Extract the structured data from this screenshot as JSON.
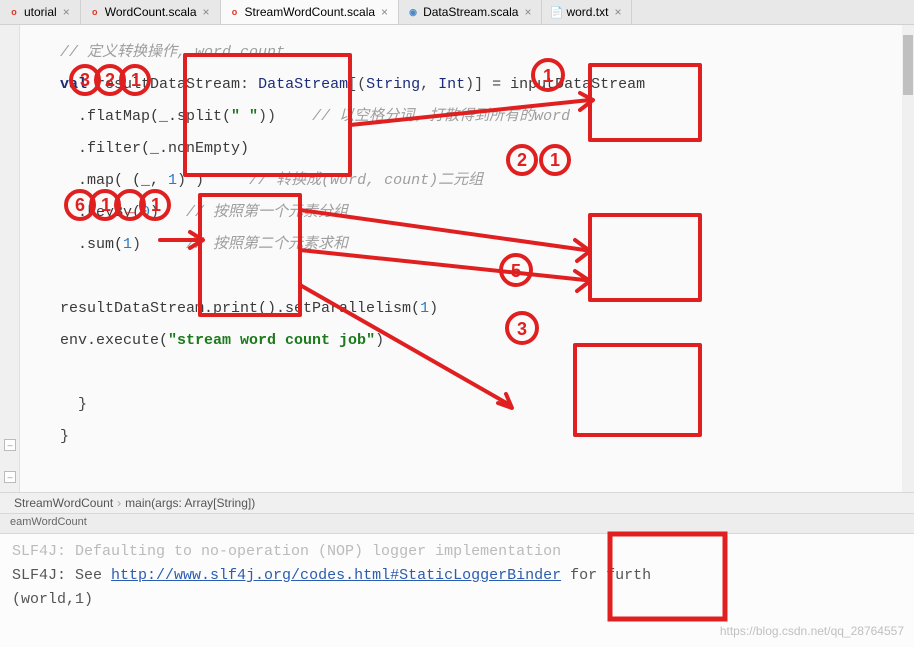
{
  "tabs": [
    {
      "name": "utorial",
      "ext": "scala",
      "active": false
    },
    {
      "name": "WordCount.scala",
      "ext": "scala",
      "active": false
    },
    {
      "name": "StreamWordCount.scala",
      "ext": "scala",
      "active": true
    },
    {
      "name": "DataStream.scala",
      "ext": "java",
      "active": false
    },
    {
      "name": "word.txt",
      "ext": "txt",
      "active": false
    }
  ],
  "code": {
    "c1_prefix": "// ",
    "c1_text": "定义转换操作, word count",
    "l_val": "val",
    "l_ident": " resultDataStream",
    "l_colon": ": ",
    "l_type": "DataStream",
    "l_brk_open": "[(",
    "l_string_t": "String",
    "l_comma": ", ",
    "l_int_t": "Int",
    "l_brk_close": ")] = ",
    "l_rhs": "inputDataStream",
    "fm_call": "  .flatMap(_.split(",
    "fm_arg": "\" \"",
    "fm_close": "))",
    "fm_pad": "    ",
    "fm_c": "// 以空格分词，打散得到所有的word",
    "fl_call": "  .filter(_.nonEmpty)",
    "mp_call": "  .map( (_, ",
    "mp_num": "1",
    "mp_close": ") )     ",
    "mp_c": "// 转换成(word, count)二元组",
    "kb_call": "  .keyBy(",
    "kb_num": "0",
    "kb_close": ")   ",
    "kb_c": "// 按照第一个元素分组",
    "sm_call": "  .sum(",
    "sm_num": "1",
    "sm_close": ")     ",
    "sm_c": "// 按照第二个元素求和",
    "pr_call": "resultDataStream.print().setParallelism(",
    "pr_num": "1",
    "pr_close": ")",
    "ex_call": "env.execute(",
    "ex_str": "\"stream word count job\"",
    "ex_close": ")",
    "brace1": "  }",
    "brace2": "}"
  },
  "breadcrumb": {
    "part1": "StreamWordCount",
    "part2": "main(args: Array[String])"
  },
  "console_tab": "eamWordCount",
  "console": {
    "l1": "SLF4J: Defaulting to no-operation (NOP) logger implementation",
    "l2_a": "SLF4J: See ",
    "l2_link": "http://www.slf4j.org/codes.html#StaticLoggerBinder",
    "l2_b": " for furth",
    "l3": "(world,1)"
  },
  "watermark": "https://blog.csdn.net/qq_28764557"
}
